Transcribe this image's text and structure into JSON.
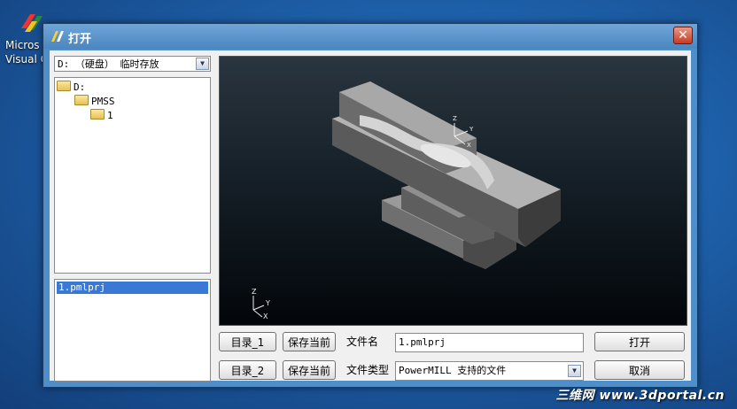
{
  "desktop": {
    "icon_label_1": "Micros",
    "icon_label_2": "Visual C"
  },
  "dialog": {
    "title": "打开",
    "close_glyph": "✕"
  },
  "drive_select": {
    "value": "D: （硬盘） 临时存放"
  },
  "folder_tree": [
    {
      "label": "D:"
    },
    {
      "label": "PMSS"
    },
    {
      "label": "1"
    }
  ],
  "file_list": [
    {
      "label": "1.pmlprj"
    }
  ],
  "buttons": {
    "dir1": "目录_1",
    "dir2": "目录_2",
    "save_current_1": "保存当前",
    "save_current_2": "保存当前",
    "open": "打开",
    "cancel": "取消"
  },
  "fields": {
    "filename_label": "文件名",
    "filename_value": "1.pmlprj",
    "filetype_label": "文件类型",
    "filetype_value": "PowerMILL 支持的文件"
  },
  "preview": {
    "axis_z": "Z",
    "axis_y": "Y",
    "axis_x": "X"
  },
  "watermark": "三维网 www.3dportal.cn",
  "colors": {
    "selection": "#3a78d6",
    "close": "#c73a22"
  }
}
